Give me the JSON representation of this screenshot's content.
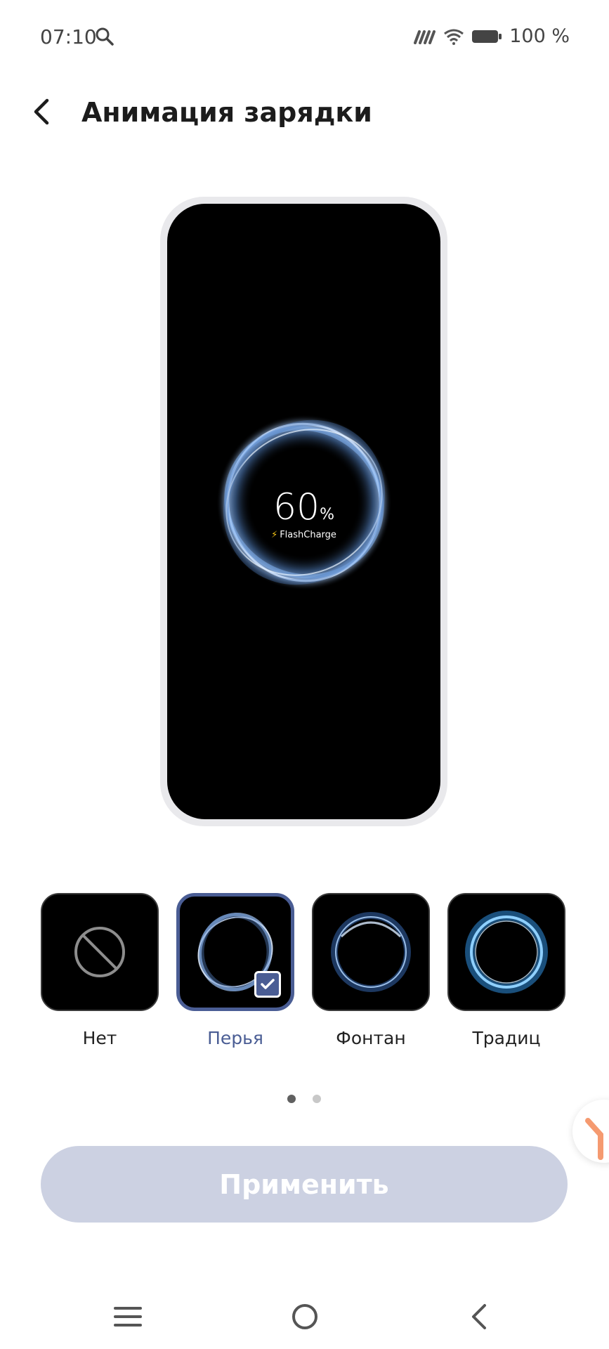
{
  "status_bar": {
    "time": "07:10",
    "battery_text": "100 %",
    "icons": [
      "search-icon",
      "signal-icon",
      "wifi-icon",
      "battery-icon"
    ]
  },
  "header": {
    "title": "Анимация зарядки",
    "back_icon": "back-arrow-icon"
  },
  "preview": {
    "percent": "60",
    "percent_sign": "%",
    "brand": "FlashCharge"
  },
  "options": [
    {
      "label": "Нет",
      "selected": false,
      "icon": "none-icon"
    },
    {
      "label": "Перья",
      "selected": true,
      "icon": "feather-ring-icon"
    },
    {
      "label": "Фонтан",
      "selected": false,
      "icon": "fountain-ring-icon"
    },
    {
      "label": "Традиц",
      "selected": false,
      "icon": "traditional-ring-icon"
    }
  ],
  "pagination": {
    "pages": 2,
    "current": 1
  },
  "apply_button": {
    "label": "Применить"
  },
  "colors": {
    "accent": "#4a5d94",
    "apply_bg": "#ccd1e2",
    "ring_glow": "#7fb8ff"
  },
  "nav_bar": {
    "icons": [
      "menu-icon",
      "home-icon",
      "back-icon"
    ]
  }
}
